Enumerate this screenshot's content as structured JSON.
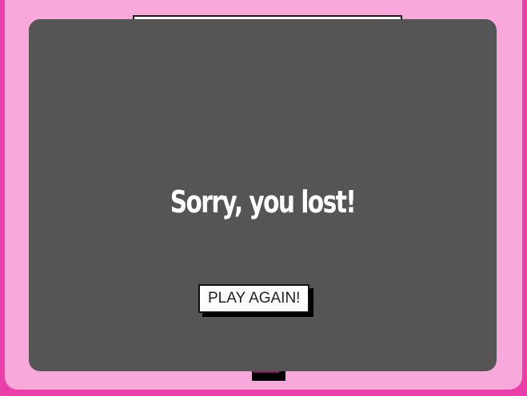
{
  "overlay": {
    "message": "Sorry, you lost!",
    "play_again_label": "PLAY AGAIN!"
  },
  "colors": {
    "page_background": "#ea3ea9",
    "frame_background": "#f9a8db",
    "overlay_background": "#555555",
    "text": "#ffffff",
    "button_background": "#ffffff"
  }
}
